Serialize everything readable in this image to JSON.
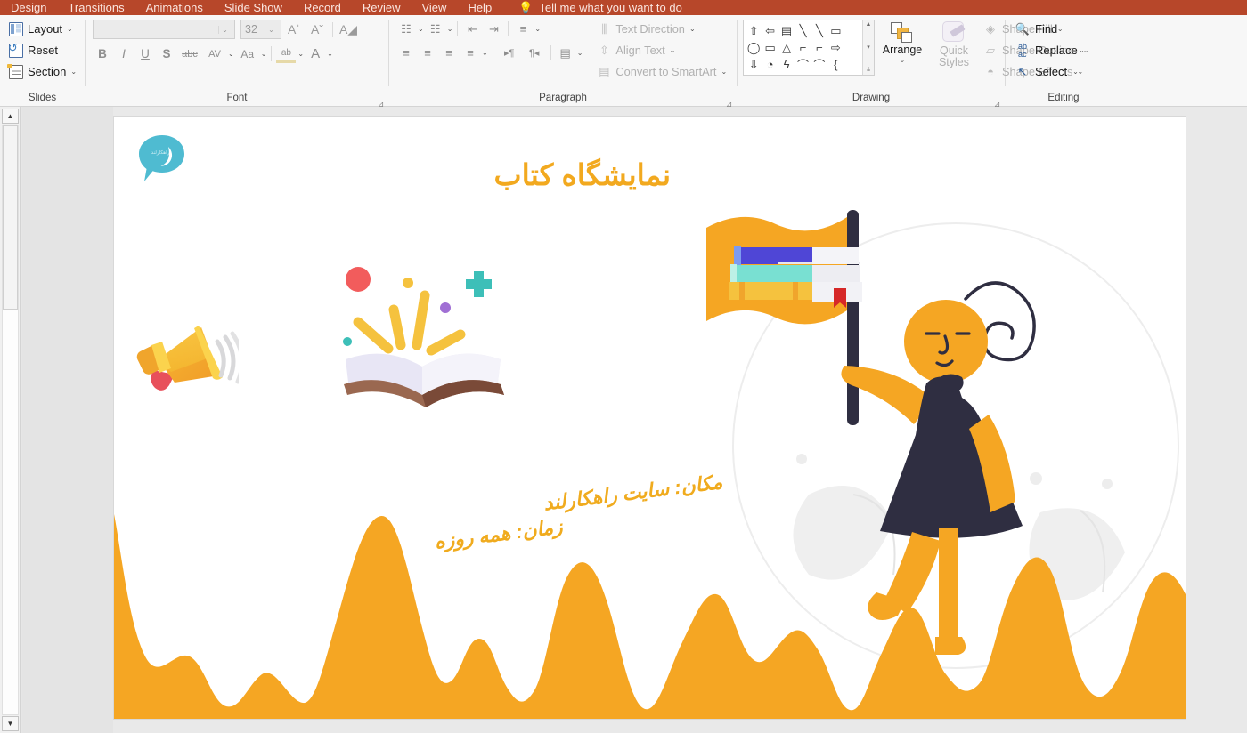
{
  "app": {
    "tabs": [
      {
        "label": "Design"
      },
      {
        "label": "Transitions"
      },
      {
        "label": "Animations"
      },
      {
        "label": "Slide Show"
      },
      {
        "label": "Record"
      },
      {
        "label": "Review"
      },
      {
        "label": "View"
      },
      {
        "label": "Help"
      }
    ],
    "tellme": "Tell me what you want to do"
  },
  "ribbon": {
    "groups": {
      "slides": {
        "name": "Slides",
        "buttons": [
          {
            "label": "Layout",
            "caret": "⌄"
          },
          {
            "label": "Reset",
            "caret": ""
          },
          {
            "label": "Section",
            "caret": "⌄"
          }
        ]
      },
      "font": {
        "name": "Font",
        "font_name_value": "",
        "font_name_placeholder": "",
        "font_size_value": "32",
        "row1": [
          {
            "name": "increase-font-size",
            "glyph": "Aˈ"
          },
          {
            "name": "decrease-font-size",
            "glyph": "Aˇ"
          },
          {
            "name": "clear-formatting",
            "glyph": "A◢"
          }
        ],
        "row2": [
          {
            "name": "bold",
            "glyph": "B"
          },
          {
            "name": "italic",
            "glyph": "I"
          },
          {
            "name": "underline",
            "glyph": "U"
          },
          {
            "name": "text-shadow",
            "glyph": "S"
          },
          {
            "name": "strikethrough",
            "glyph": "abc"
          },
          {
            "name": "character-spacing",
            "glyph": "AV"
          },
          {
            "name": "change-case",
            "glyph": "Aa"
          },
          {
            "name": "text-highlight-color",
            "glyph": "ab"
          },
          {
            "name": "font-color",
            "glyph": "A"
          }
        ]
      },
      "paragraph": {
        "name": "Paragraph",
        "row1": [
          {
            "name": "bullets",
            "glyph": "☷"
          },
          {
            "name": "numbering",
            "glyph": "☷"
          },
          {
            "name": "decrease-indent",
            "glyph": "⇤"
          },
          {
            "name": "increase-indent",
            "glyph": "⇥"
          },
          {
            "name": "line-spacing",
            "glyph": "≡"
          }
        ],
        "row2": [
          {
            "name": "align-left",
            "glyph": "≡"
          },
          {
            "name": "align-center",
            "glyph": "≡"
          },
          {
            "name": "align-right",
            "glyph": "≡"
          },
          {
            "name": "justify",
            "glyph": "≡"
          },
          {
            "name": "ltr-text-direction",
            "glyph": "▸¶"
          },
          {
            "name": "rtl-text-direction",
            "glyph": "¶◂"
          },
          {
            "name": "columns",
            "glyph": "▤"
          }
        ],
        "labels": [
          {
            "label": "Text Direction",
            "caret": "⌄"
          },
          {
            "label": "Align Text",
            "caret": "⌄"
          },
          {
            "label": "Convert to SmartArt",
            "caret": "⌄"
          }
        ]
      },
      "drawing": {
        "name": "Drawing",
        "shapes": [
          "⇧",
          "⇦",
          "▤",
          "╲",
          "╲",
          "▭",
          "",
          "◯",
          "▭",
          "△",
          "⌐",
          "⌐",
          "⇨",
          "",
          "⇩",
          "◔",
          "ϟ",
          "⌒",
          "⌒",
          "{",
          ""
        ],
        "arrange_label": "Arrange",
        "arrange_caret": "⌄",
        "quick_styles_label_1": "Quick",
        "quick_styles_label_2": "Styles",
        "quick_styles_caret": "⌄",
        "shape_buttons": [
          {
            "label": "Shape Fill",
            "caret": "⌄"
          },
          {
            "label": "Shape Outline",
            "caret": "⌄"
          },
          {
            "label": "Shape Effects",
            "caret": "⌄"
          }
        ]
      },
      "editing": {
        "name": "Editing",
        "buttons": [
          {
            "label": "Find",
            "caret": ""
          },
          {
            "label": "Replace",
            "caret": "⌄"
          },
          {
            "label": "Select",
            "caret": "⌄"
          }
        ]
      }
    }
  },
  "slide": {
    "logo_text": "راهکارلند",
    "title": "نمایشگاه کتاب",
    "info_lines": [
      "مکان: سایت راهکارلند",
      "زمان: همه روزه"
    ],
    "colors": {
      "orange_wave": "#F5A623",
      "title_orange": "#F2A91F",
      "logo_teal": "#4FBBD1",
      "dark_navy": "#2F2E41",
      "flag_orange": "#F5A623",
      "confetti_red": "#F25C5C",
      "confetti_teal": "#3DBFB8",
      "confetti_purple": "#A06FD4",
      "confetti_yellow": "#F5C23E",
      "ribbon_tabbar": "#B7472A"
    }
  }
}
